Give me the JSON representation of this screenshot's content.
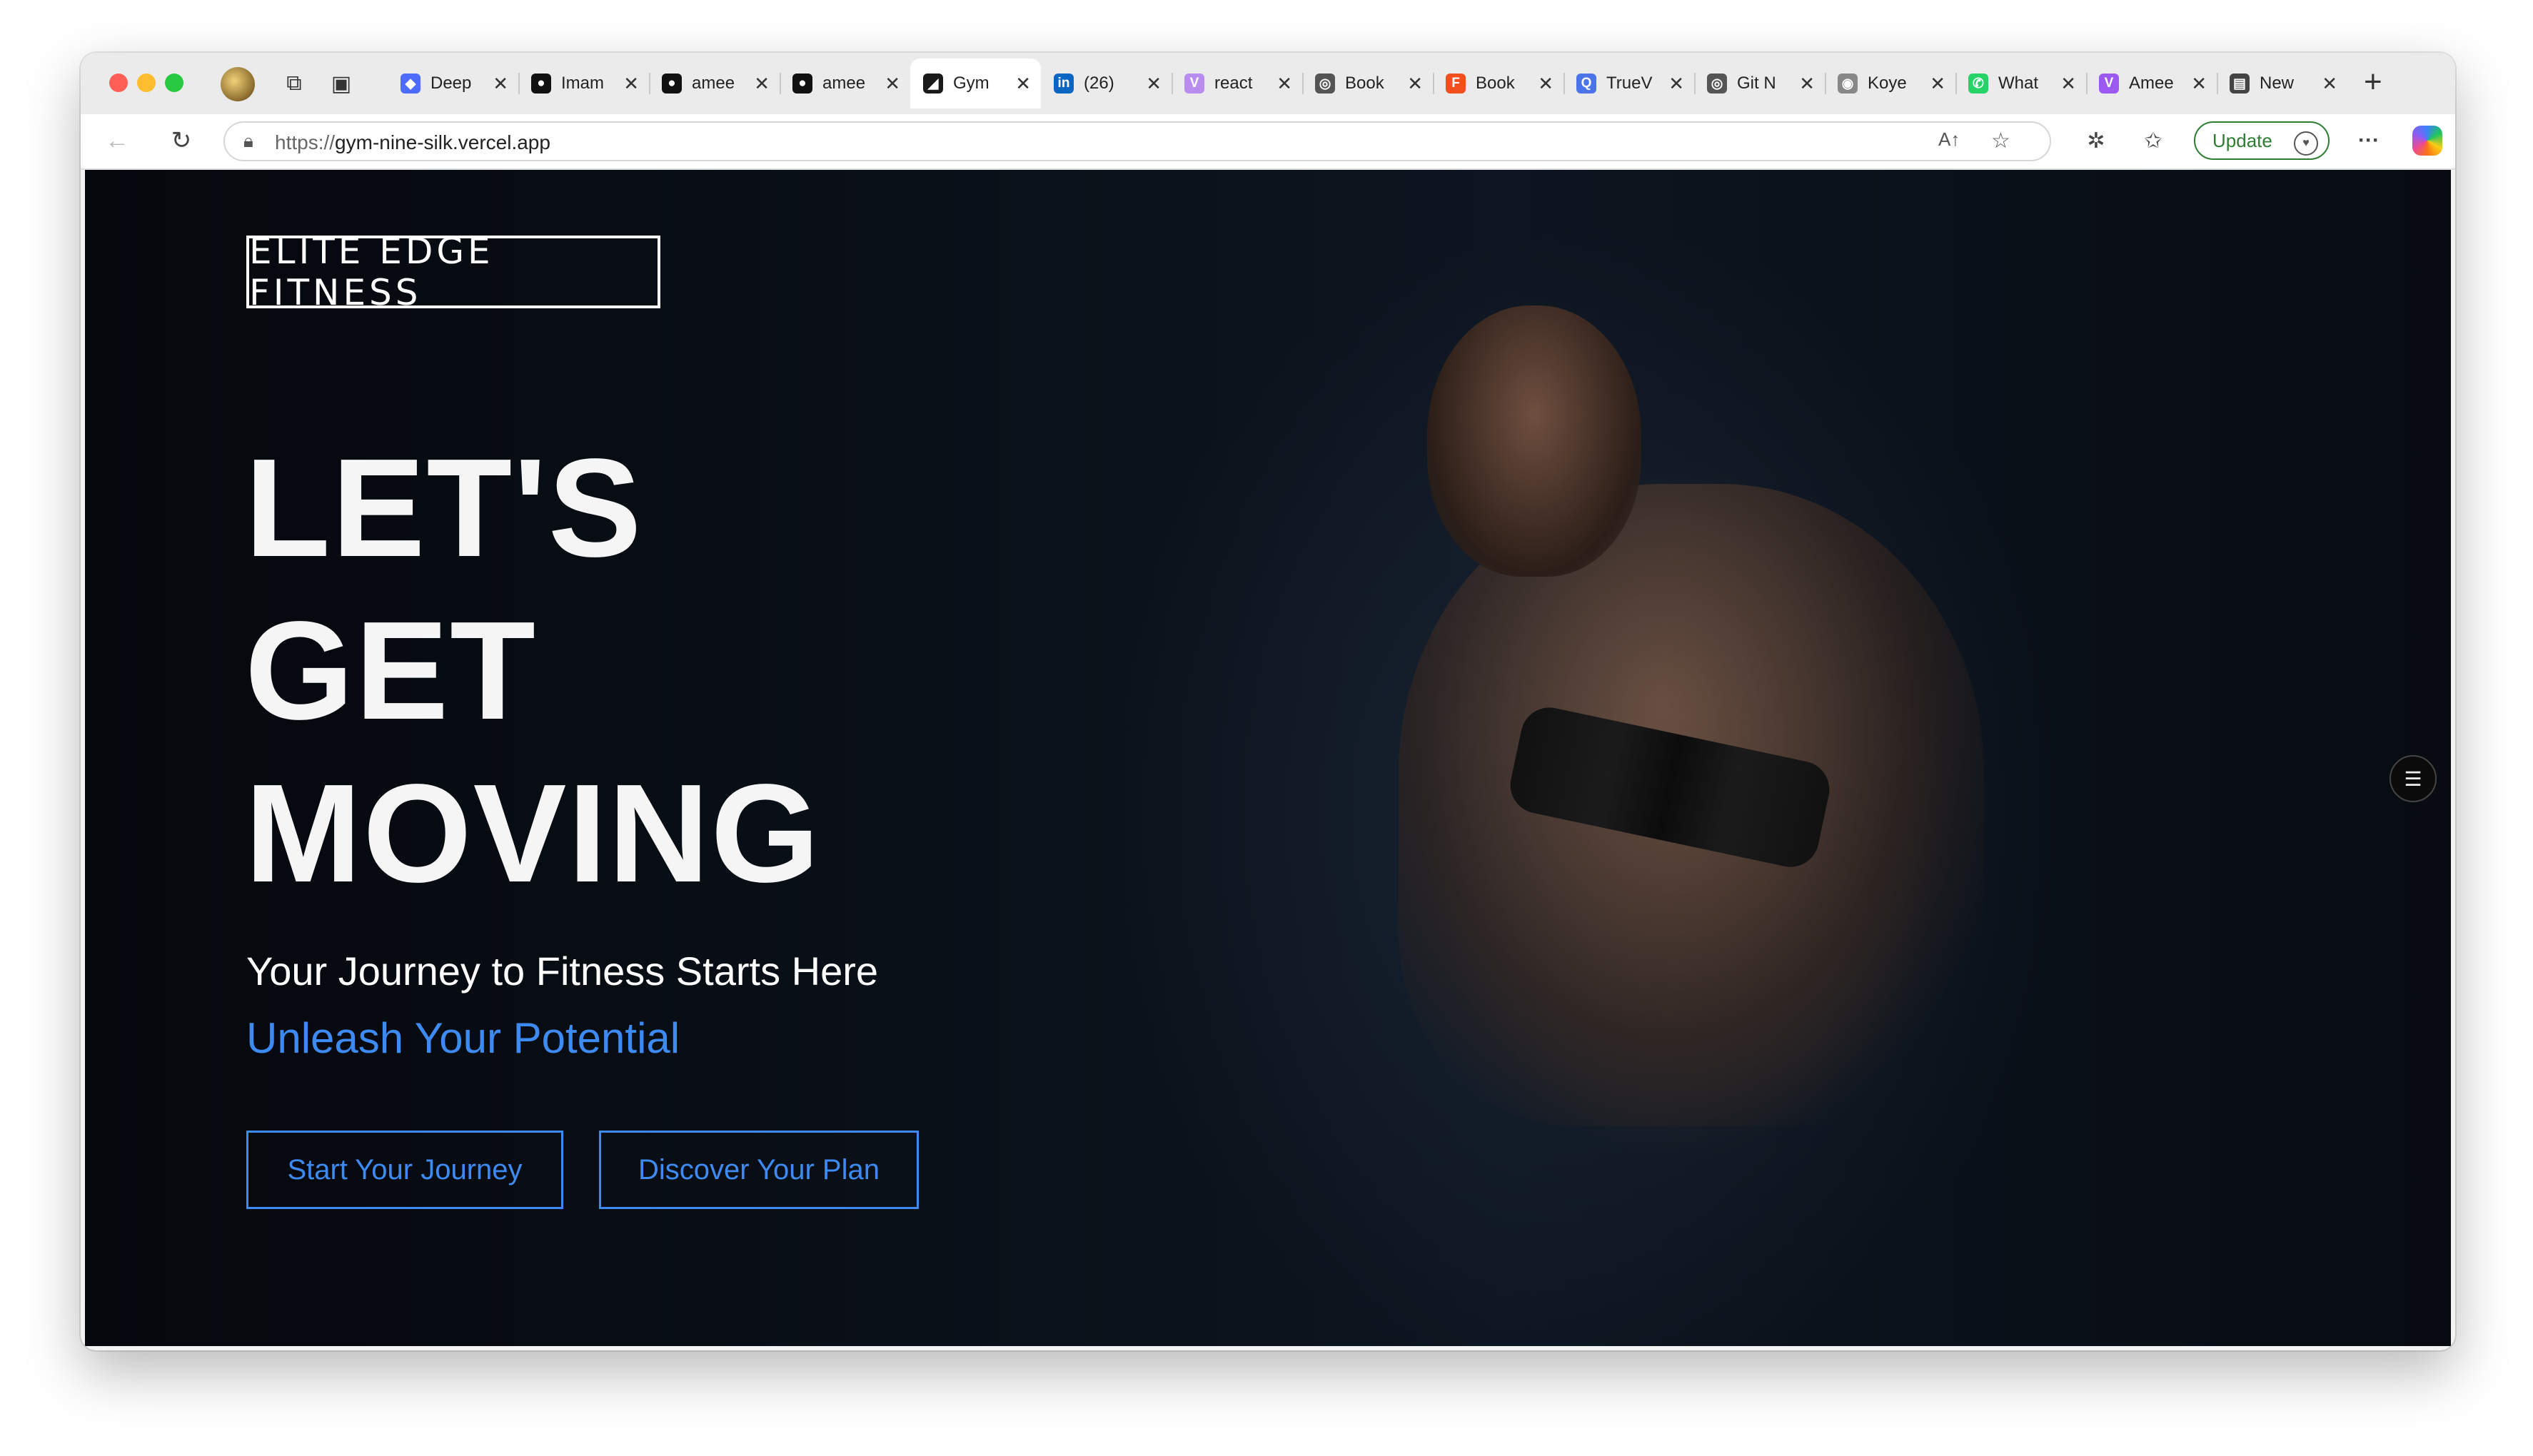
{
  "browser": {
    "tabs": [
      {
        "title": "Deep",
        "icon": "deepseek-icon",
        "color": "#4d6bfe",
        "glyph": "◆",
        "active": false
      },
      {
        "title": "Imam",
        "icon": "github-icon",
        "color": "#111111",
        "glyph": "●",
        "active": false
      },
      {
        "title": "amee",
        "icon": "github-icon",
        "color": "#111111",
        "glyph": "●",
        "active": false
      },
      {
        "title": "amee",
        "icon": "github-icon",
        "color": "#111111",
        "glyph": "●",
        "active": false
      },
      {
        "title": "Gym",
        "icon": "gym-site-icon",
        "color": "#1a1a1a",
        "glyph": "◢",
        "active": true
      },
      {
        "title": "(26)",
        "icon": "linkedin-icon",
        "color": "#0a66c2",
        "glyph": "in",
        "active": false
      },
      {
        "title": "react",
        "icon": "vite-icon",
        "color": "#b98cf0",
        "glyph": "V",
        "active": false
      },
      {
        "title": "Book",
        "icon": "globe-icon",
        "color": "#555555",
        "glyph": "◎",
        "active": false
      },
      {
        "title": "Book",
        "icon": "figma-icon",
        "color": "#f24e1e",
        "glyph": "F",
        "active": false
      },
      {
        "title": "TrueV",
        "icon": "truevault-icon",
        "color": "#4a74e8",
        "glyph": "Q",
        "active": false
      },
      {
        "title": "Git N",
        "icon": "globe-icon",
        "color": "#555555",
        "glyph": "◎",
        "active": false
      },
      {
        "title": "Koye",
        "icon": "koyeb-icon",
        "color": "#888888",
        "glyph": "◉",
        "active": false
      },
      {
        "title": "What",
        "icon": "whatsapp-icon",
        "color": "#25d366",
        "glyph": "✆",
        "active": false
      },
      {
        "title": "Amee",
        "icon": "vite-icon",
        "color": "#9b59f0",
        "glyph": "V",
        "active": false
      },
      {
        "title": "New",
        "icon": "new-tab-page-icon",
        "color": "#444444",
        "glyph": "▤",
        "active": false
      }
    ],
    "tab_close_glyph": "✕",
    "new_tab_glyph": "+",
    "url_scheme": "https://",
    "url_host": "gym-nine-silk.vercel.app",
    "update_label": "Update",
    "more_glyph": "···"
  },
  "page": {
    "logo": "ELITE EDGE FITNESS",
    "headline_lines": [
      "LET'S",
      "GET",
      "MOVING"
    ],
    "subtitle": "Your Journey to Fitness Starts Here",
    "tagline": "Unleash Your Potential",
    "cta_primary": "Start Your Journey",
    "cta_secondary": "Discover Your Plan",
    "accent_color": "#3d8bf2"
  }
}
